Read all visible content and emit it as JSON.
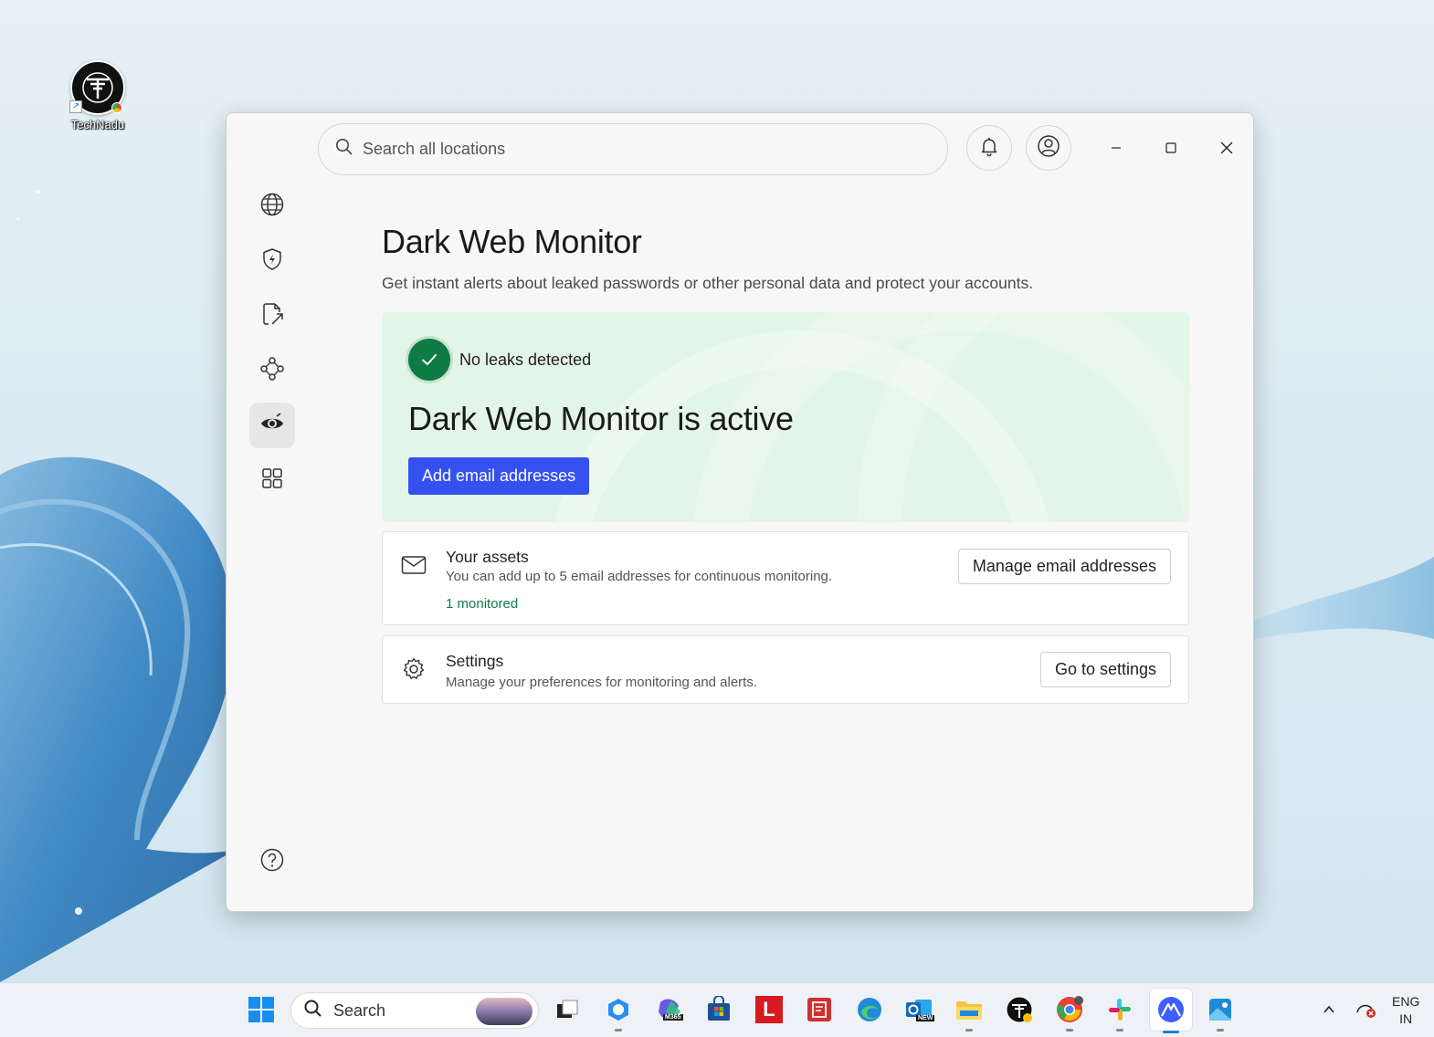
{
  "desktop": {
    "shortcut_label": "TechNadu"
  },
  "window": {
    "search": {
      "placeholder": "Search all locations"
    },
    "sidebar": {
      "items": [
        {
          "name": "globe-icon",
          "active": false
        },
        {
          "name": "shield-bolt-icon",
          "active": false
        },
        {
          "name": "file-share-icon",
          "active": false
        },
        {
          "name": "mesh-network-icon",
          "active": false
        },
        {
          "name": "eye-icon",
          "active": true
        },
        {
          "name": "apps-grid-icon",
          "active": false
        }
      ],
      "help_icon": "question-circle-icon"
    },
    "page": {
      "title": "Dark Web Monitor",
      "subtitle": "Get instant alerts about leaked passwords or other personal data and protect your accounts."
    },
    "status_card": {
      "status_text": "No leaks detected",
      "heading": "Dark Web Monitor is active",
      "button_label": "Add email addresses",
      "accent": "#3451f0",
      "background": "#e3f5e6",
      "check_color": "#0e7a45"
    },
    "assets_card": {
      "title": "Your assets",
      "description": "You can add up to 5 email addresses for continuous monitoring.",
      "count_text": "1 monitored",
      "button_label": "Manage email addresses"
    },
    "settings_card": {
      "title": "Settings",
      "description": "Manage your preferences for monitoring and alerts.",
      "button_label": "Go to settings"
    }
  },
  "taskbar": {
    "search_label": "Search",
    "tray": {
      "lang_line1": "ENG",
      "lang_line2": "IN"
    },
    "m365_badge": "M365",
    "outlook_badge": "NEW",
    "l_app_letter": "L"
  }
}
